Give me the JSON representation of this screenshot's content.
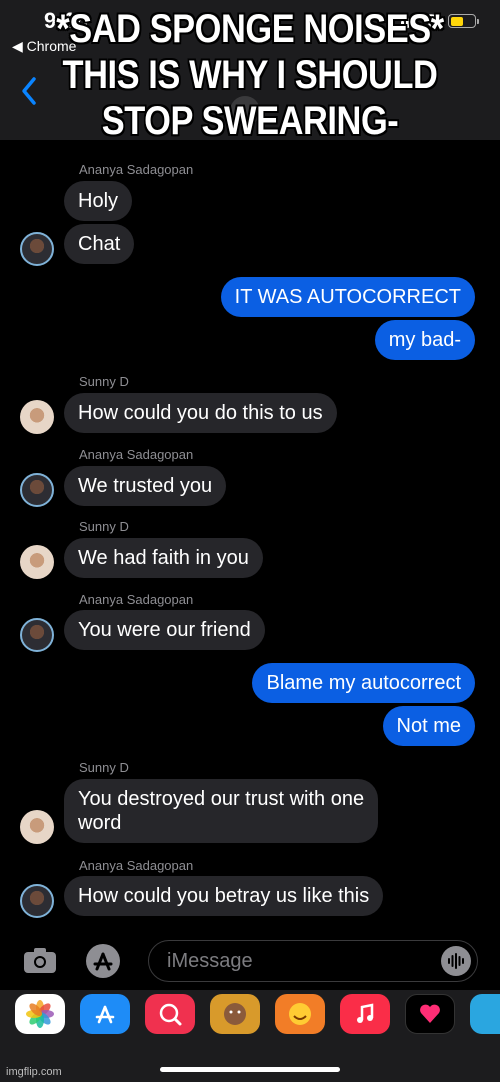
{
  "status": {
    "time": "9:16",
    "back_app": "◀ Chrome"
  },
  "caption": "*SAD SPONGE NOISES* THIS IS WHY I SHOULD STOP SWEARING-",
  "messages": [
    {
      "sender": "Ananya Sadagopan",
      "text": "Holy"
    },
    {
      "text": "Chat"
    },
    {
      "text": "IT WAS AUTOCORRECT"
    },
    {
      "text": "my bad-"
    },
    {
      "sender": "Sunny D",
      "text": "How could you do this to us"
    },
    {
      "sender": "Ananya Sadagopan",
      "text": "We trusted you"
    },
    {
      "sender": "Sunny D",
      "text": "We had faith in you"
    },
    {
      "sender": "Ananya Sadagopan",
      "text": "You were our friend"
    },
    {
      "text": "Blame my autocorrect"
    },
    {
      "text": "Not me"
    },
    {
      "sender": "Sunny D",
      "text_line1": "You destroyed our trust with one",
      "text_line2": "word"
    },
    {
      "sender": "Ananya Sadagopan",
      "text": "How could you betray us like this"
    }
  ],
  "input": {
    "placeholder": "iMessage"
  },
  "watermark": "imgflip.com",
  "colors": {
    "outgoing": "#0b5fe3",
    "incoming": "#26262a",
    "background": "#000000"
  }
}
